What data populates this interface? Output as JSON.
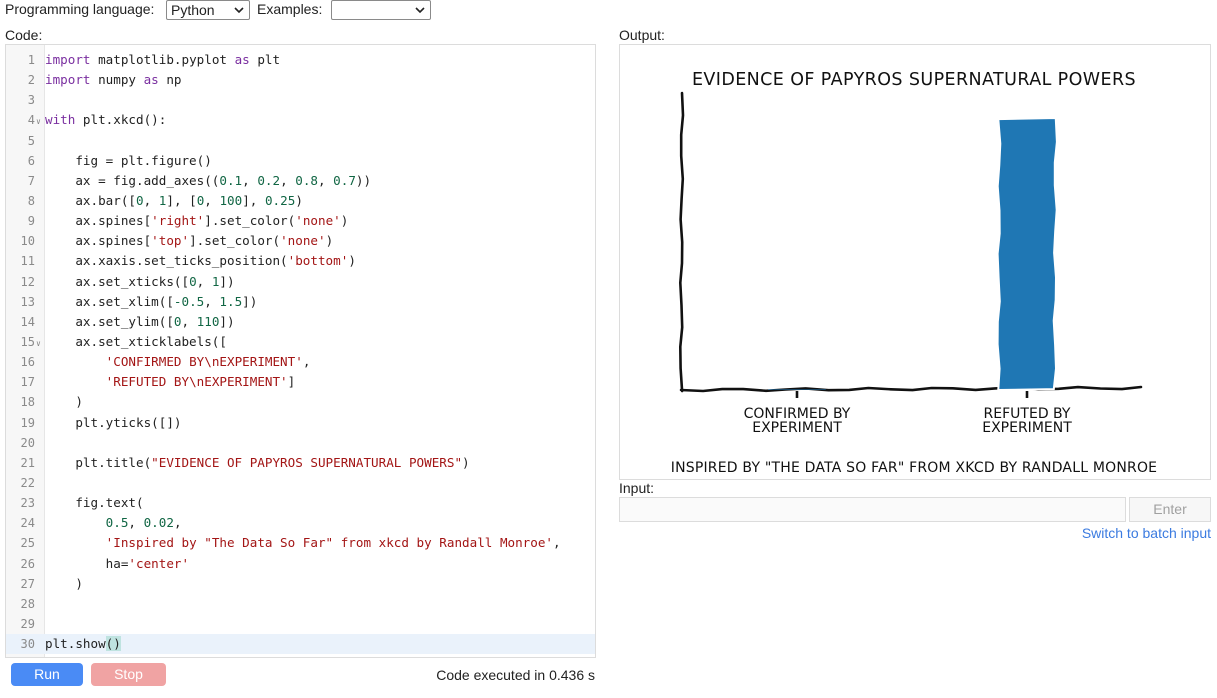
{
  "toolbar": {
    "language_label": "Programming language:",
    "language_value": "Python",
    "examples_label": "Examples:",
    "examples_value": ""
  },
  "code_panel": {
    "label": "Code:"
  },
  "code_lines": [
    {
      "n": "1",
      "fold": false,
      "segs": [
        [
          "kw",
          "import"
        ],
        [
          "t",
          " matplotlib.pyplot "
        ],
        [
          "kw",
          "as"
        ],
        [
          "t",
          " plt"
        ]
      ]
    },
    {
      "n": "2",
      "fold": false,
      "segs": [
        [
          "kw",
          "import"
        ],
        [
          "t",
          " numpy "
        ],
        [
          "kw",
          "as"
        ],
        [
          "t",
          " np"
        ]
      ]
    },
    {
      "n": "3",
      "fold": false,
      "segs": []
    },
    {
      "n": "4",
      "fold": true,
      "segs": [
        [
          "kw",
          "with"
        ],
        [
          "t",
          " plt.xkcd():"
        ]
      ]
    },
    {
      "n": "5",
      "fold": false,
      "segs": []
    },
    {
      "n": "6",
      "fold": false,
      "segs": [
        [
          "t",
          "    fig = plt.figure()"
        ]
      ]
    },
    {
      "n": "7",
      "fold": false,
      "segs": [
        [
          "t",
          "    ax = fig.add_axes(("
        ],
        [
          "num",
          "0.1"
        ],
        [
          "t",
          ", "
        ],
        [
          "num",
          "0.2"
        ],
        [
          "t",
          ", "
        ],
        [
          "num",
          "0.8"
        ],
        [
          "t",
          ", "
        ],
        [
          "num",
          "0.7"
        ],
        [
          "t",
          "))"
        ]
      ]
    },
    {
      "n": "8",
      "fold": false,
      "segs": [
        [
          "t",
          "    ax.bar(["
        ],
        [
          "num",
          "0"
        ],
        [
          "t",
          ", "
        ],
        [
          "num",
          "1"
        ],
        [
          "t",
          "], ["
        ],
        [
          "num",
          "0"
        ],
        [
          "t",
          ", "
        ],
        [
          "num",
          "100"
        ],
        [
          "t",
          "], "
        ],
        [
          "num",
          "0.25"
        ],
        [
          "t",
          ")"
        ]
      ]
    },
    {
      "n": "9",
      "fold": false,
      "segs": [
        [
          "t",
          "    ax.spines["
        ],
        [
          "str",
          "'right'"
        ],
        [
          "t",
          "].set_color("
        ],
        [
          "str",
          "'none'"
        ],
        [
          "t",
          ")"
        ]
      ]
    },
    {
      "n": "10",
      "fold": false,
      "segs": [
        [
          "t",
          "    ax.spines["
        ],
        [
          "str",
          "'top'"
        ],
        [
          "t",
          "].set_color("
        ],
        [
          "str",
          "'none'"
        ],
        [
          "t",
          ")"
        ]
      ]
    },
    {
      "n": "11",
      "fold": false,
      "segs": [
        [
          "t",
          "    ax.xaxis.set_ticks_position("
        ],
        [
          "str",
          "'bottom'"
        ],
        [
          "t",
          ")"
        ]
      ]
    },
    {
      "n": "12",
      "fold": false,
      "segs": [
        [
          "t",
          "    ax.set_xticks(["
        ],
        [
          "num",
          "0"
        ],
        [
          "t",
          ", "
        ],
        [
          "num",
          "1"
        ],
        [
          "t",
          "])"
        ]
      ]
    },
    {
      "n": "13",
      "fold": false,
      "segs": [
        [
          "t",
          "    ax.set_xlim(["
        ],
        [
          "num",
          "-0.5"
        ],
        [
          "t",
          ", "
        ],
        [
          "num",
          "1.5"
        ],
        [
          "t",
          "])"
        ]
      ]
    },
    {
      "n": "14",
      "fold": false,
      "segs": [
        [
          "t",
          "    ax.set_ylim(["
        ],
        [
          "num",
          "0"
        ],
        [
          "t",
          ", "
        ],
        [
          "num",
          "110"
        ],
        [
          "t",
          "])"
        ]
      ]
    },
    {
      "n": "15",
      "fold": true,
      "segs": [
        [
          "t",
          "    ax.set_xticklabels(["
        ]
      ]
    },
    {
      "n": "16",
      "fold": false,
      "segs": [
        [
          "t",
          "        "
        ],
        [
          "str",
          "'CONFIRMED BY\\nEXPERIMENT'"
        ],
        [
          "t",
          ","
        ]
      ]
    },
    {
      "n": "17",
      "fold": false,
      "segs": [
        [
          "t",
          "        "
        ],
        [
          "str",
          "'REFUTED BY\\nEXPERIMENT'"
        ],
        [
          "t",
          "]"
        ]
      ]
    },
    {
      "n": "18",
      "fold": false,
      "segs": [
        [
          "t",
          "    )"
        ]
      ]
    },
    {
      "n": "19",
      "fold": false,
      "segs": [
        [
          "t",
          "    plt.yticks([])"
        ]
      ]
    },
    {
      "n": "20",
      "fold": false,
      "segs": []
    },
    {
      "n": "21",
      "fold": false,
      "segs": [
        [
          "t",
          "    plt.title("
        ],
        [
          "str",
          "\"EVIDENCE OF PAPYROS SUPERNATURAL POWERS\""
        ],
        [
          "t",
          ")"
        ]
      ]
    },
    {
      "n": "22",
      "fold": false,
      "segs": []
    },
    {
      "n": "23",
      "fold": false,
      "segs": [
        [
          "t",
          "    fig.text("
        ]
      ]
    },
    {
      "n": "24",
      "fold": false,
      "segs": [
        [
          "t",
          "        "
        ],
        [
          "num",
          "0.5"
        ],
        [
          "t",
          ", "
        ],
        [
          "num",
          "0.02"
        ],
        [
          "t",
          ","
        ]
      ]
    },
    {
      "n": "25",
      "fold": false,
      "segs": [
        [
          "t",
          "        "
        ],
        [
          "str",
          "'Inspired by \"The Data So Far\" from xkcd by Randall Monroe'"
        ],
        [
          "t",
          ","
        ]
      ]
    },
    {
      "n": "26",
      "fold": false,
      "segs": [
        [
          "t",
          "        ha="
        ],
        [
          "str",
          "'center'"
        ]
      ]
    },
    {
      "n": "27",
      "fold": false,
      "segs": [
        [
          "t",
          "    )"
        ]
      ]
    },
    {
      "n": "28",
      "fold": false,
      "segs": []
    },
    {
      "n": "29",
      "fold": false,
      "segs": []
    },
    {
      "n": "30",
      "fold": false,
      "active": true,
      "segs": [
        [
          "t",
          "plt.show"
        ],
        [
          "hl",
          "()"
        ]
      ]
    }
  ],
  "controls": {
    "run_label": "Run",
    "stop_label": "Stop",
    "exec_status": "Code executed in 0.436 s"
  },
  "output_panel": {
    "label": "Output:"
  },
  "chart_data": {
    "type": "bar",
    "title": "EVIDENCE OF PAPYROS SUPERNATURAL POWERS",
    "categories": [
      "CONFIRMED BY\nEXPERIMENT",
      "REFUTED BY\nEXPERIMENT"
    ],
    "values": [
      0,
      100
    ],
    "xlim": [
      -0.5,
      1.5
    ],
    "ylim": [
      0,
      110
    ],
    "bar_color": "#1f77b4",
    "footer": "INSPIRED BY \"THE DATA SO FAR\" FROM XKCD BY RANDALL MONROE",
    "grid": false
  },
  "input_panel": {
    "label": "Input:",
    "value": "",
    "enter_label": "Enter",
    "batch_link": "Switch to batch input"
  },
  "colors": {
    "run": "#4a8bf5",
    "stop": "#f0a3a3",
    "link": "#3b7be0"
  }
}
